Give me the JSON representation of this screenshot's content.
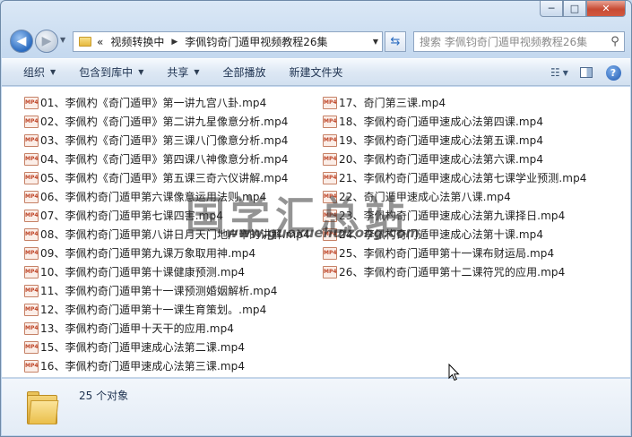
{
  "window": {
    "caption": {
      "minimize": "─",
      "maximize": "□",
      "close": "✕"
    }
  },
  "nav": {
    "history_chevron": "«",
    "breadcrumb": [
      "视频转换中",
      "李佩钧奇门遁甲视频教程26集"
    ],
    "search_placeholder": "搜索 李佩钧奇门遁甲视频教程26集"
  },
  "toolbar": {
    "items": [
      "组织",
      "包含到库中",
      "共享",
      "全部播放",
      "新建文件夹"
    ]
  },
  "file_icon_label": "MP4",
  "files_left": [
    "01、李佩杓《奇门遁甲》第一讲九宫八卦.mp4",
    "02、李佩杓《奇门遁甲》第二讲九星像意分析.mp4",
    "03、李佩杓《奇门遁甲》第三课八门像意分析.mp4",
    "04、李佩杓《奇门遁甲》第四课八神像意分析.mp4",
    "05、李佩杓《奇门遁甲》第五课三奇六仪讲解.mp4",
    "06、李佩杓奇门遁甲第六课像意运用法则.mp4",
    "07、李佩杓奇门遁甲第七课四害.mp4",
    "08、李佩杓奇门遁甲第八讲日月天门地户辛的讲解.mp4",
    "09、李佩杓奇门遁甲第九课万象取用神.mp4",
    "10、李佩杓奇门遁甲第十课健康预测.mp4",
    "11、李佩杓奇门遁甲第十一课预测婚姻解析.mp4",
    "12、李佩杓奇门遁甲第十一课生育策划。.mp4",
    "13、李佩杓奇门遁甲十天干的应用.mp4",
    "15、李佩杓奇门遁甲速成心法第二课.mp4",
    "16、李佩杓奇门遁甲速成心法第三课.mp4"
  ],
  "files_right": [
    "17、奇门第三课.mp4",
    "18、李佩杓奇门遁甲速成心法第四课.mp4",
    "19、李佩杓奇门遁甲速成心法第五课.mp4",
    "20、李佩杓奇门遁甲速成心法第六课.mp4",
    "21、李佩杓奇门遁甲速成心法第七课学业预测.mp4",
    "22、奇门遁甲速成心法第八课.mp4",
    "23、李佩杓奇门遁甲速成心法第九课择日.mp4",
    "24、李佩杓奇门遁甲速成心法第十课.mp4",
    "25、李佩杓奇门遁甲第十一课布财运局.mp4",
    "26、李佩杓奇门遁甲第十二课符咒的应用.mp4"
  ],
  "watermark": {
    "chinese": "国学汇总站",
    "url": "www.guoxuehuizong.com"
  },
  "details": {
    "count": "25 个对象"
  },
  "colors": {
    "window_chrome": "#c5d9ef",
    "close_button": "#c74a33",
    "mp4_icon": "#c0472a"
  }
}
